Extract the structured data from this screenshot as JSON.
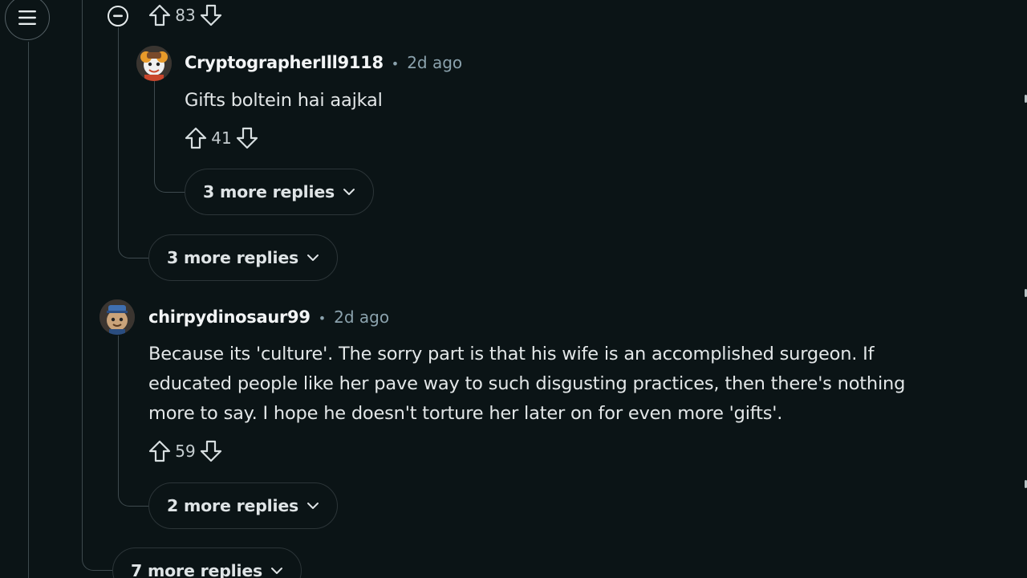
{
  "header": {
    "menu_icon": "hamburger-icon",
    "collapse_icon": "minus-circle-icon",
    "top_vote_count": "83"
  },
  "comments": [
    {
      "author": "CryptographerIll9118",
      "separator": "•",
      "time": "2d ago",
      "body": "Gifts boltein hai aajkal",
      "votes": "41",
      "more_replies": "3 more replies"
    },
    {
      "author": "chirpydinosaur99",
      "separator": "•",
      "time": "2d ago",
      "body": "Because its 'culture'. The sorry part is that his wife is an accomplished surgeon. If educated people like her pave way to such disgusting practices, then there's nothing more to say. I hope he doesn't torture her later on for even more 'gifts'.",
      "votes": "59",
      "more_replies": "2 more replies"
    }
  ],
  "parent_more_replies": "3 more replies",
  "outer_more_replies": "7 more replies",
  "colors": {
    "background": "#0b1416",
    "thread_line": "#3e4a4e",
    "meta_text": "#8ba2ad"
  }
}
